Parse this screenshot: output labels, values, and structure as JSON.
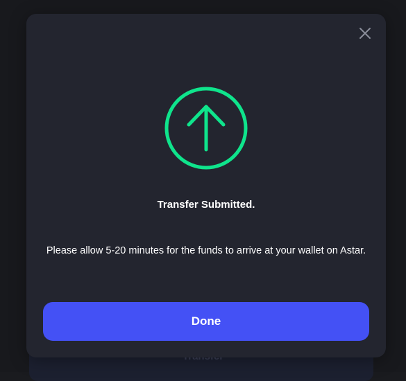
{
  "modal": {
    "status": "submitted",
    "title": "Transfer Submitted.",
    "message": "Please allow 5-20 minutes for the funds to arrive at your wallet on Astar.",
    "done_label": "Done",
    "close_icon": "close-icon",
    "status_icon": "arrow-up-circle-icon"
  },
  "background": {
    "button_label": "Transfer"
  },
  "colors": {
    "accent_green": "#0fe48c",
    "primary_button": "#4451f5",
    "modal_bg": "#23252f",
    "close_icon": "#8a8d9a"
  }
}
